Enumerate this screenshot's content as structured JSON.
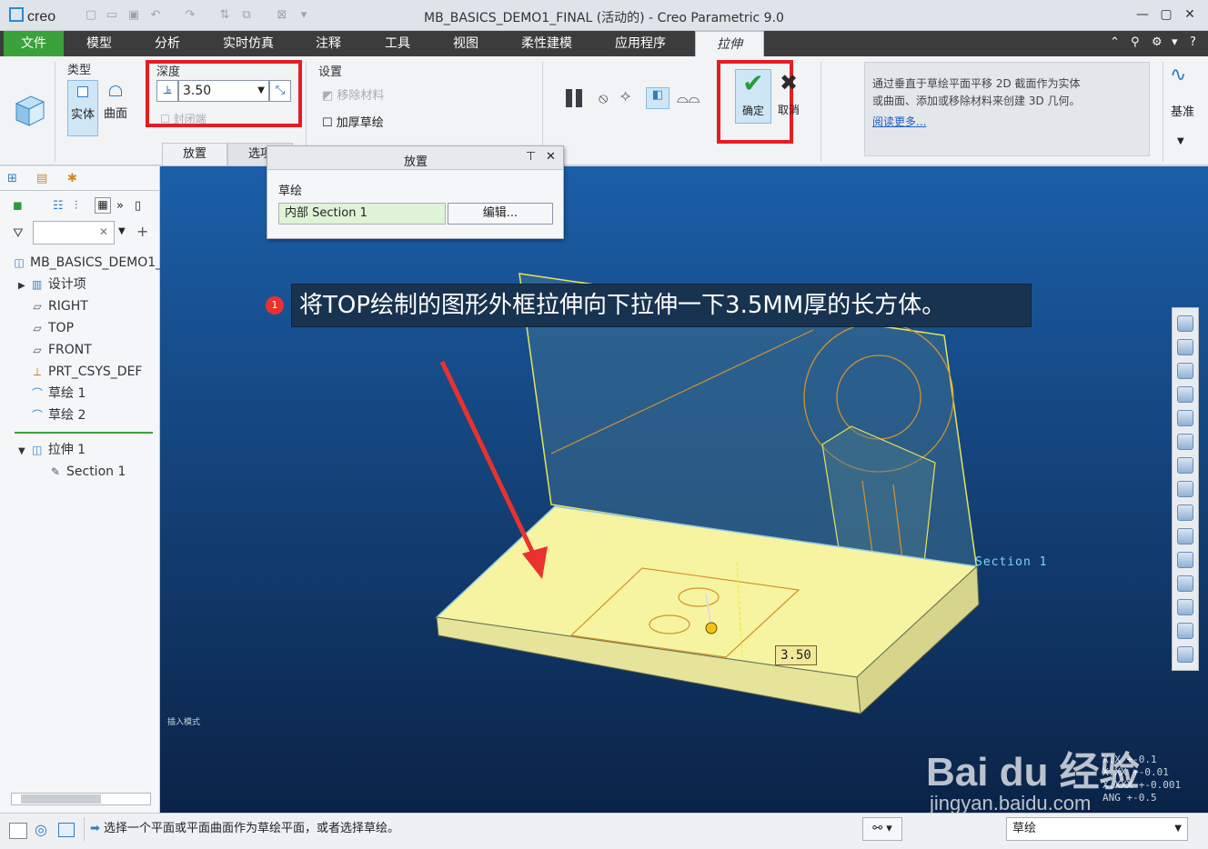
{
  "app": {
    "logo": "creo",
    "window_title": "MB_BASICS_DEMO1_FINAL (活动的) - Creo Parametric 9.0"
  },
  "tabs": [
    "文件",
    "模型",
    "分析",
    "实时仿真",
    "注释",
    "工具",
    "视图",
    "柔性建模",
    "应用程序",
    "拉伸"
  ],
  "ribbon": {
    "type_label": "类型",
    "solid": "实体",
    "surface": "曲面",
    "depth_label": "深度",
    "depth_value": "3.50",
    "cap_ends": "封闭端",
    "settings_label": "设置",
    "remove_material": "移除材料",
    "thicken_sketch": "加厚草绘",
    "ok": "确定",
    "cancel": "取消",
    "help_text": "通过垂直于草绘平面平移 2D 截面作为实体或曲面、添加或移除材料来创建 3D 几何。",
    "read_more": "阅读更多...",
    "datum": "基准",
    "subtabs": [
      "放置",
      "选项"
    ]
  },
  "placement_popup": {
    "title": "放置",
    "sketch_label": "草绘",
    "section_value": "内部 Section 1",
    "edit_button": "编辑..."
  },
  "model_tree": {
    "root": "MB_BASICS_DEMO1_",
    "items": [
      "设计项",
      "RIGHT",
      "TOP",
      "FRONT",
      "PRT_CSYS_DEF",
      "草绘 1",
      "草绘 2"
    ],
    "feature": "拉伸 1",
    "feature_child": "Section 1"
  },
  "viewport": {
    "annotation": "将TOP绘制的图形外框拉伸向下拉伸一下3.5MM厚的长方体。",
    "annotation_num": "1",
    "dimension": "3.50",
    "section_label": "Section 1",
    "insert_mode": "插入模式",
    "tolerances": [
      "X.X +-0.1",
      "X.XX +-0.01",
      "X.XXX +-0.001",
      "ANG +-0.5"
    ],
    "watermark_brand": "Bai du 经验",
    "watermark_url": "jingyan.baidu.com"
  },
  "status": {
    "message": "选择一个平面或平面曲面作为草绘平面，或者选择草绘。",
    "filter_value": "草绘"
  }
}
